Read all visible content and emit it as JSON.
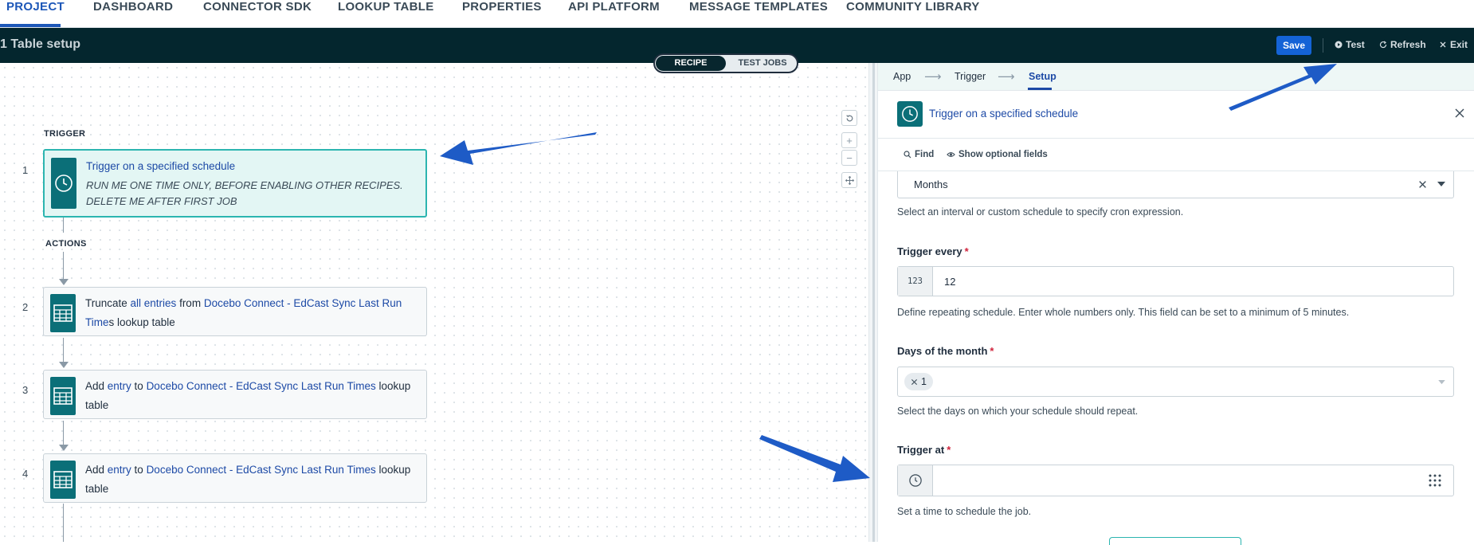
{
  "top_nav": {
    "items": [
      "PROJECT",
      "DASHBOARD",
      "CONNECTOR SDK",
      "LOOKUP TABLE",
      "PROPERTIES",
      "API PLATFORM",
      "MESSAGE TEMPLATES",
      "COMMUNITY LIBRARY"
    ],
    "active": "PROJECT"
  },
  "header": {
    "title": "1 Table setup",
    "save_label": "Save",
    "test_label": "Test",
    "refresh_label": "Refresh",
    "exit_label": "Exit"
  },
  "toggle": {
    "recipe": "RECIPE",
    "test_jobs": "TEST JOBS"
  },
  "recipe": {
    "trigger_heading": "TRIGGER",
    "actions_heading": "ACTIONS",
    "steps": [
      {
        "num": "1",
        "prefix": "",
        "link1": "Trigger on a specified schedule",
        "mid": "",
        "link2": "",
        "suffix": "",
        "sub": "RUN ME ONE TIME ONLY, BEFORE ENABLING OTHER RECIPES. DELETE ME AFTER FIRST JOB"
      },
      {
        "num": "2",
        "prefix": "Truncate ",
        "link1": "all entries",
        "mid": " from ",
        "link2": "Docebo Connect - EdCast Sync Last Run Time",
        "suffix": "s lookup table"
      },
      {
        "num": "3",
        "prefix": "Add ",
        "link1": "entry",
        "mid": " to ",
        "link2": "Docebo Connect - EdCast Sync Last Run Times",
        "suffix": " lookup table"
      },
      {
        "num": "4",
        "prefix": "Add ",
        "link1": "entry",
        "mid": " to ",
        "link2": "Docebo Connect - EdCast Sync Last Run Times",
        "suffix": " lookup table"
      }
    ]
  },
  "panel": {
    "crumbs": [
      "App",
      "Trigger",
      "Setup"
    ],
    "crumb_active": "Setup",
    "title": "Trigger on a specified schedule",
    "find_label": "Find",
    "optional_label": "Show optional fields",
    "schedule": {
      "value": "Months",
      "help": "Select an interval or custom schedule to specify cron expression."
    },
    "trigger_every": {
      "label": "Trigger every",
      "prefix": "123",
      "value": "12",
      "help": "Define repeating schedule. Enter whole numbers only. This field can be set to a minimum of 5 minutes."
    },
    "days_of_month": {
      "label": "Days of the month",
      "chip": "1",
      "help": "Select the days on which your schedule should repeat."
    },
    "trigger_at": {
      "label": "Trigger at",
      "value": "",
      "help": "Set a time to schedule the job."
    }
  },
  "colors": {
    "accent": "#1d57b8",
    "header_bg": "#04262e",
    "step_icon": "#0b6f78",
    "active_card": "#2cb5b0",
    "annotation_arrow": "#1e5bc6"
  }
}
